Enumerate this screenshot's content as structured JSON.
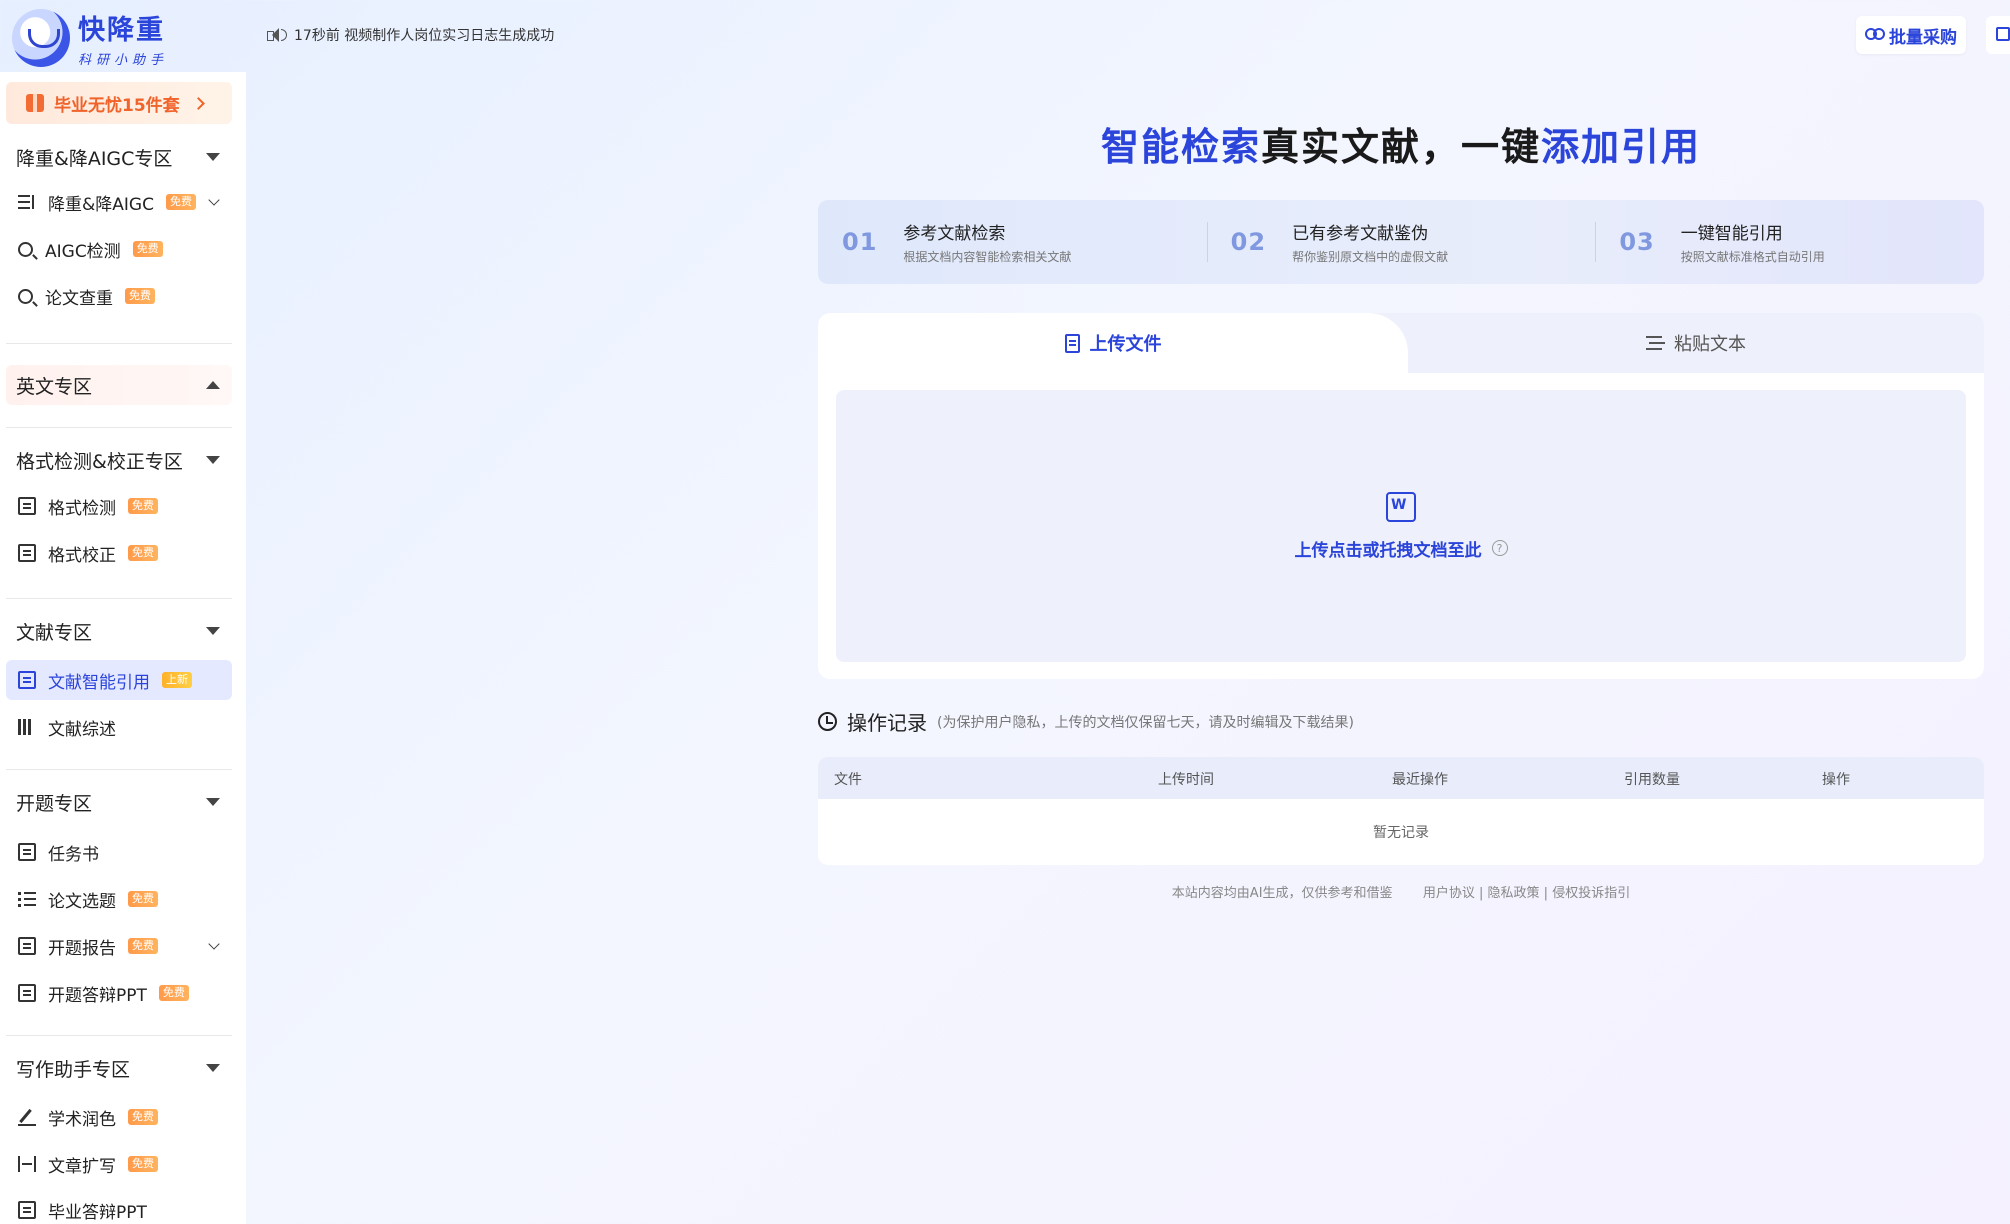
{
  "brand": {
    "title": "快降重",
    "subtitle": "科研小助手"
  },
  "notice": {
    "text": "17秒前 视频制作人岗位实习日志生成成功"
  },
  "header": {
    "bulk_label": "批量采购"
  },
  "sidebar": {
    "promo": "毕业无忧15件套",
    "sections": [
      {
        "title": "降重&降AIGC专区",
        "items": [
          {
            "label": "降重&降AIGC",
            "badge": "免费",
            "icon": "sort-icon"
          },
          {
            "label": "AIGC检测",
            "badge": "免费",
            "icon": "search-icon"
          },
          {
            "label": "论文查重",
            "badge": "免费",
            "icon": "search-icon"
          }
        ]
      },
      {
        "title": "英文专区",
        "items": []
      },
      {
        "title": "格式检测&校正专区",
        "items": [
          {
            "label": "格式检测",
            "badge": "免费",
            "icon": "doc-icon"
          },
          {
            "label": "格式校正",
            "badge": "免费",
            "icon": "doc-icon"
          }
        ]
      },
      {
        "title": "文献专区",
        "items": [
          {
            "label": "文献智能引用",
            "badge": "上新",
            "icon": "doc-icon"
          },
          {
            "label": "文献综述",
            "badge": "",
            "icon": "books-icon"
          }
        ]
      },
      {
        "title": "开题专区",
        "items": [
          {
            "label": "任务书",
            "badge": "",
            "icon": "doc-icon"
          },
          {
            "label": "论文选题",
            "badge": "免费",
            "icon": "list-icon"
          },
          {
            "label": "开题报告",
            "badge": "免费",
            "icon": "doc-icon"
          },
          {
            "label": "开题答辩PPT",
            "badge": "免费",
            "icon": "doc-icon"
          }
        ]
      },
      {
        "title": "写作助手专区",
        "items": [
          {
            "label": "学术润色",
            "badge": "免费",
            "icon": "pen-icon"
          },
          {
            "label": "文章扩写",
            "badge": "免费",
            "icon": "expand-icon"
          },
          {
            "label": "毕业答辩PPT",
            "badge": "",
            "icon": "doc-icon"
          }
        ]
      }
    ]
  },
  "hero": {
    "part1": "智能检索",
    "part2": "真实文献，一键",
    "part3": "添加引用"
  },
  "steps": [
    {
      "num": "01",
      "title": "参考文献检索",
      "desc": "根据文档内容智能检索相关文献"
    },
    {
      "num": "02",
      "title": "已有参考文献鉴伪",
      "desc": "帮你鉴别原文档中的虚假文献"
    },
    {
      "num": "03",
      "title": "一键智能引用",
      "desc": "按照文献标准格式自动引用"
    }
  ],
  "tabs": {
    "upload": "上传文件",
    "paste": "粘贴文本"
  },
  "upload": {
    "prompt": "上传点击或托拽文档至此",
    "help": "?"
  },
  "records": {
    "title": "操作记录",
    "note": "(为保护用户隐私，上传的文档仅保留七天，请及时编辑及下载结果)",
    "columns": [
      "文件",
      "上传时间",
      "最近操作",
      "引用数量",
      "操作"
    ],
    "empty": "暂无记录"
  },
  "footer": {
    "disclaimer": "本站内容均由AI生成，仅供参考和借鉴",
    "links": [
      "用户协议",
      "隐私政策",
      "侵权投诉指引"
    ],
    "sep": "|"
  },
  "colors": {
    "accent": "#2b44d9",
    "promo": "#f0632a",
    "badge": "#ff9a4a"
  }
}
